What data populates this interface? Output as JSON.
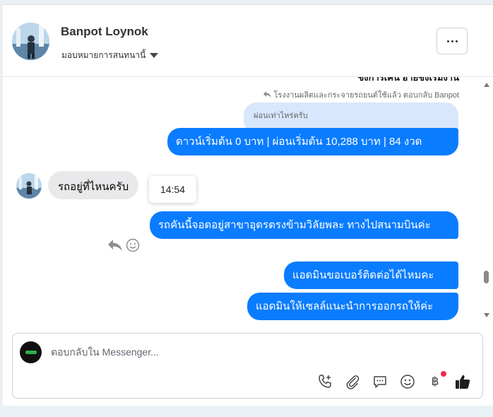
{
  "header": {
    "contact_name": "Banpot Loynok",
    "assign_label": "มอบหมายการสนทนานี้"
  },
  "chat": {
    "cut_off_text": "ชิงการเค้น ฮายชิงเริ่มงาน",
    "reply_note": "โรงงานผลิตและกระจายรถยนต์ใช้แล้ว ตอบกลับ Banpot",
    "quoted_text": "ผ่อนเท่าไหร่ครับ",
    "messages": [
      {
        "text": "ดาวน์เริ่มต้น 0 บาท | ผ่อนเริ่มต้น 10,288 บาท | 84 งวด"
      },
      {
        "text": "รถอยู่ที่ไหนครับ"
      },
      {
        "text": "รถคันนี้จอดอยู่สาขาอุดรตรงข้ามวิลัยพละ ทางไปสนามบินค่ะ"
      },
      {
        "text": "แอดมินขอเบอร์ติดต่อได้ไหมคะ"
      },
      {
        "text": "แอดมินให้เซลล์แนะนำการออกรถให้ค่ะ"
      }
    ],
    "tooltip_time": "14:54"
  },
  "composer": {
    "placeholder": "ตอบกลับใน Messenger...",
    "tool_icons": [
      "phone-plus-icon",
      "paperclip-icon",
      "chat-bubble-icon",
      "smiley-icon",
      "baht-icon",
      "thumbs-up-icon"
    ],
    "baht_symbol": "฿"
  },
  "colors": {
    "outgoing_bubble": "#0a7cff",
    "incoming_bubble": "#e9e9eb",
    "quoted_bubble": "#d8e7fb",
    "badge_dot": "#f02849"
  }
}
